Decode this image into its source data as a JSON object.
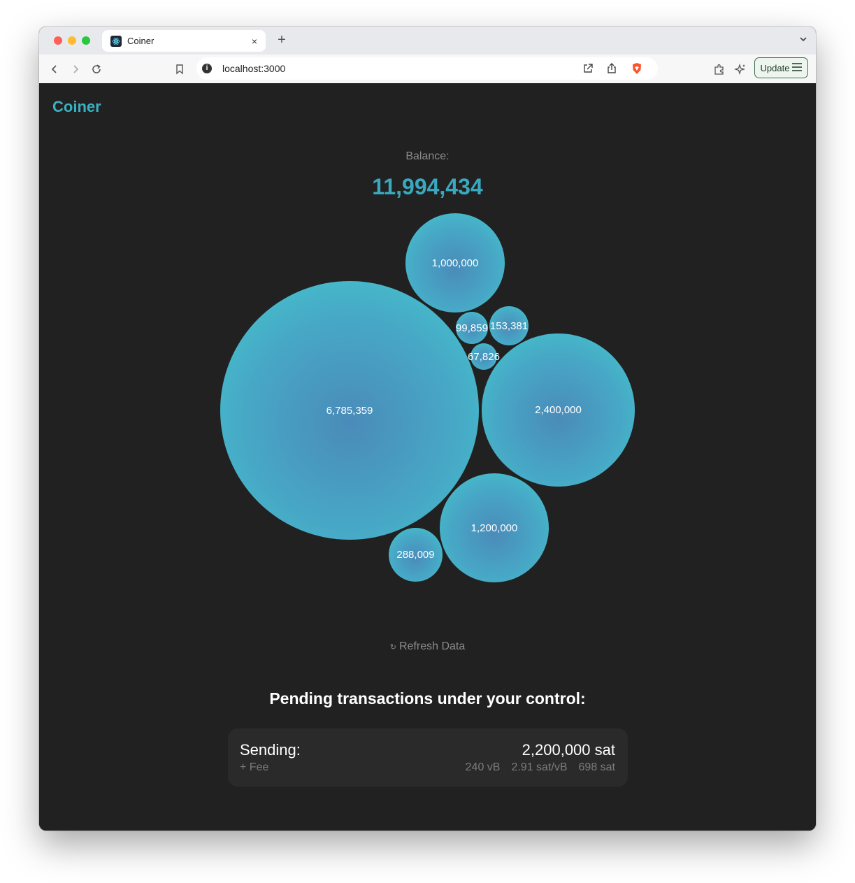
{
  "browser": {
    "tab_title": "Coiner",
    "new_tab": "+",
    "close": "×",
    "url": "localhost:3000",
    "update_label": "Update"
  },
  "app": {
    "brand": "Coiner",
    "balance_label": "Balance:",
    "balance_value": "11,994,434",
    "accent_color": "#39a9c0",
    "utxos": [
      {
        "label": "1,000,000",
        "value": 1000000
      },
      {
        "label": "99,859",
        "value": 99859
      },
      {
        "label": "153,381",
        "value": 153381
      },
      {
        "label": "67,826",
        "value": 67826
      },
      {
        "label": "6,785,359",
        "value": 6785359
      },
      {
        "label": "2,400,000",
        "value": 2400000
      },
      {
        "label": "1,200,000",
        "value": 1200000
      },
      {
        "label": "288,009",
        "value": 288009
      }
    ],
    "refresh_icon": "↻",
    "refresh_label": "Refresh Data",
    "pending_title": "Pending transactions under your control:",
    "transaction": {
      "label": "Sending:",
      "amount": "2,200,000 sat",
      "fee_label": "+ Fee",
      "vsize": "240 vB",
      "fee_rate": "2.91 sat/vB",
      "fee": "698 sat"
    }
  }
}
